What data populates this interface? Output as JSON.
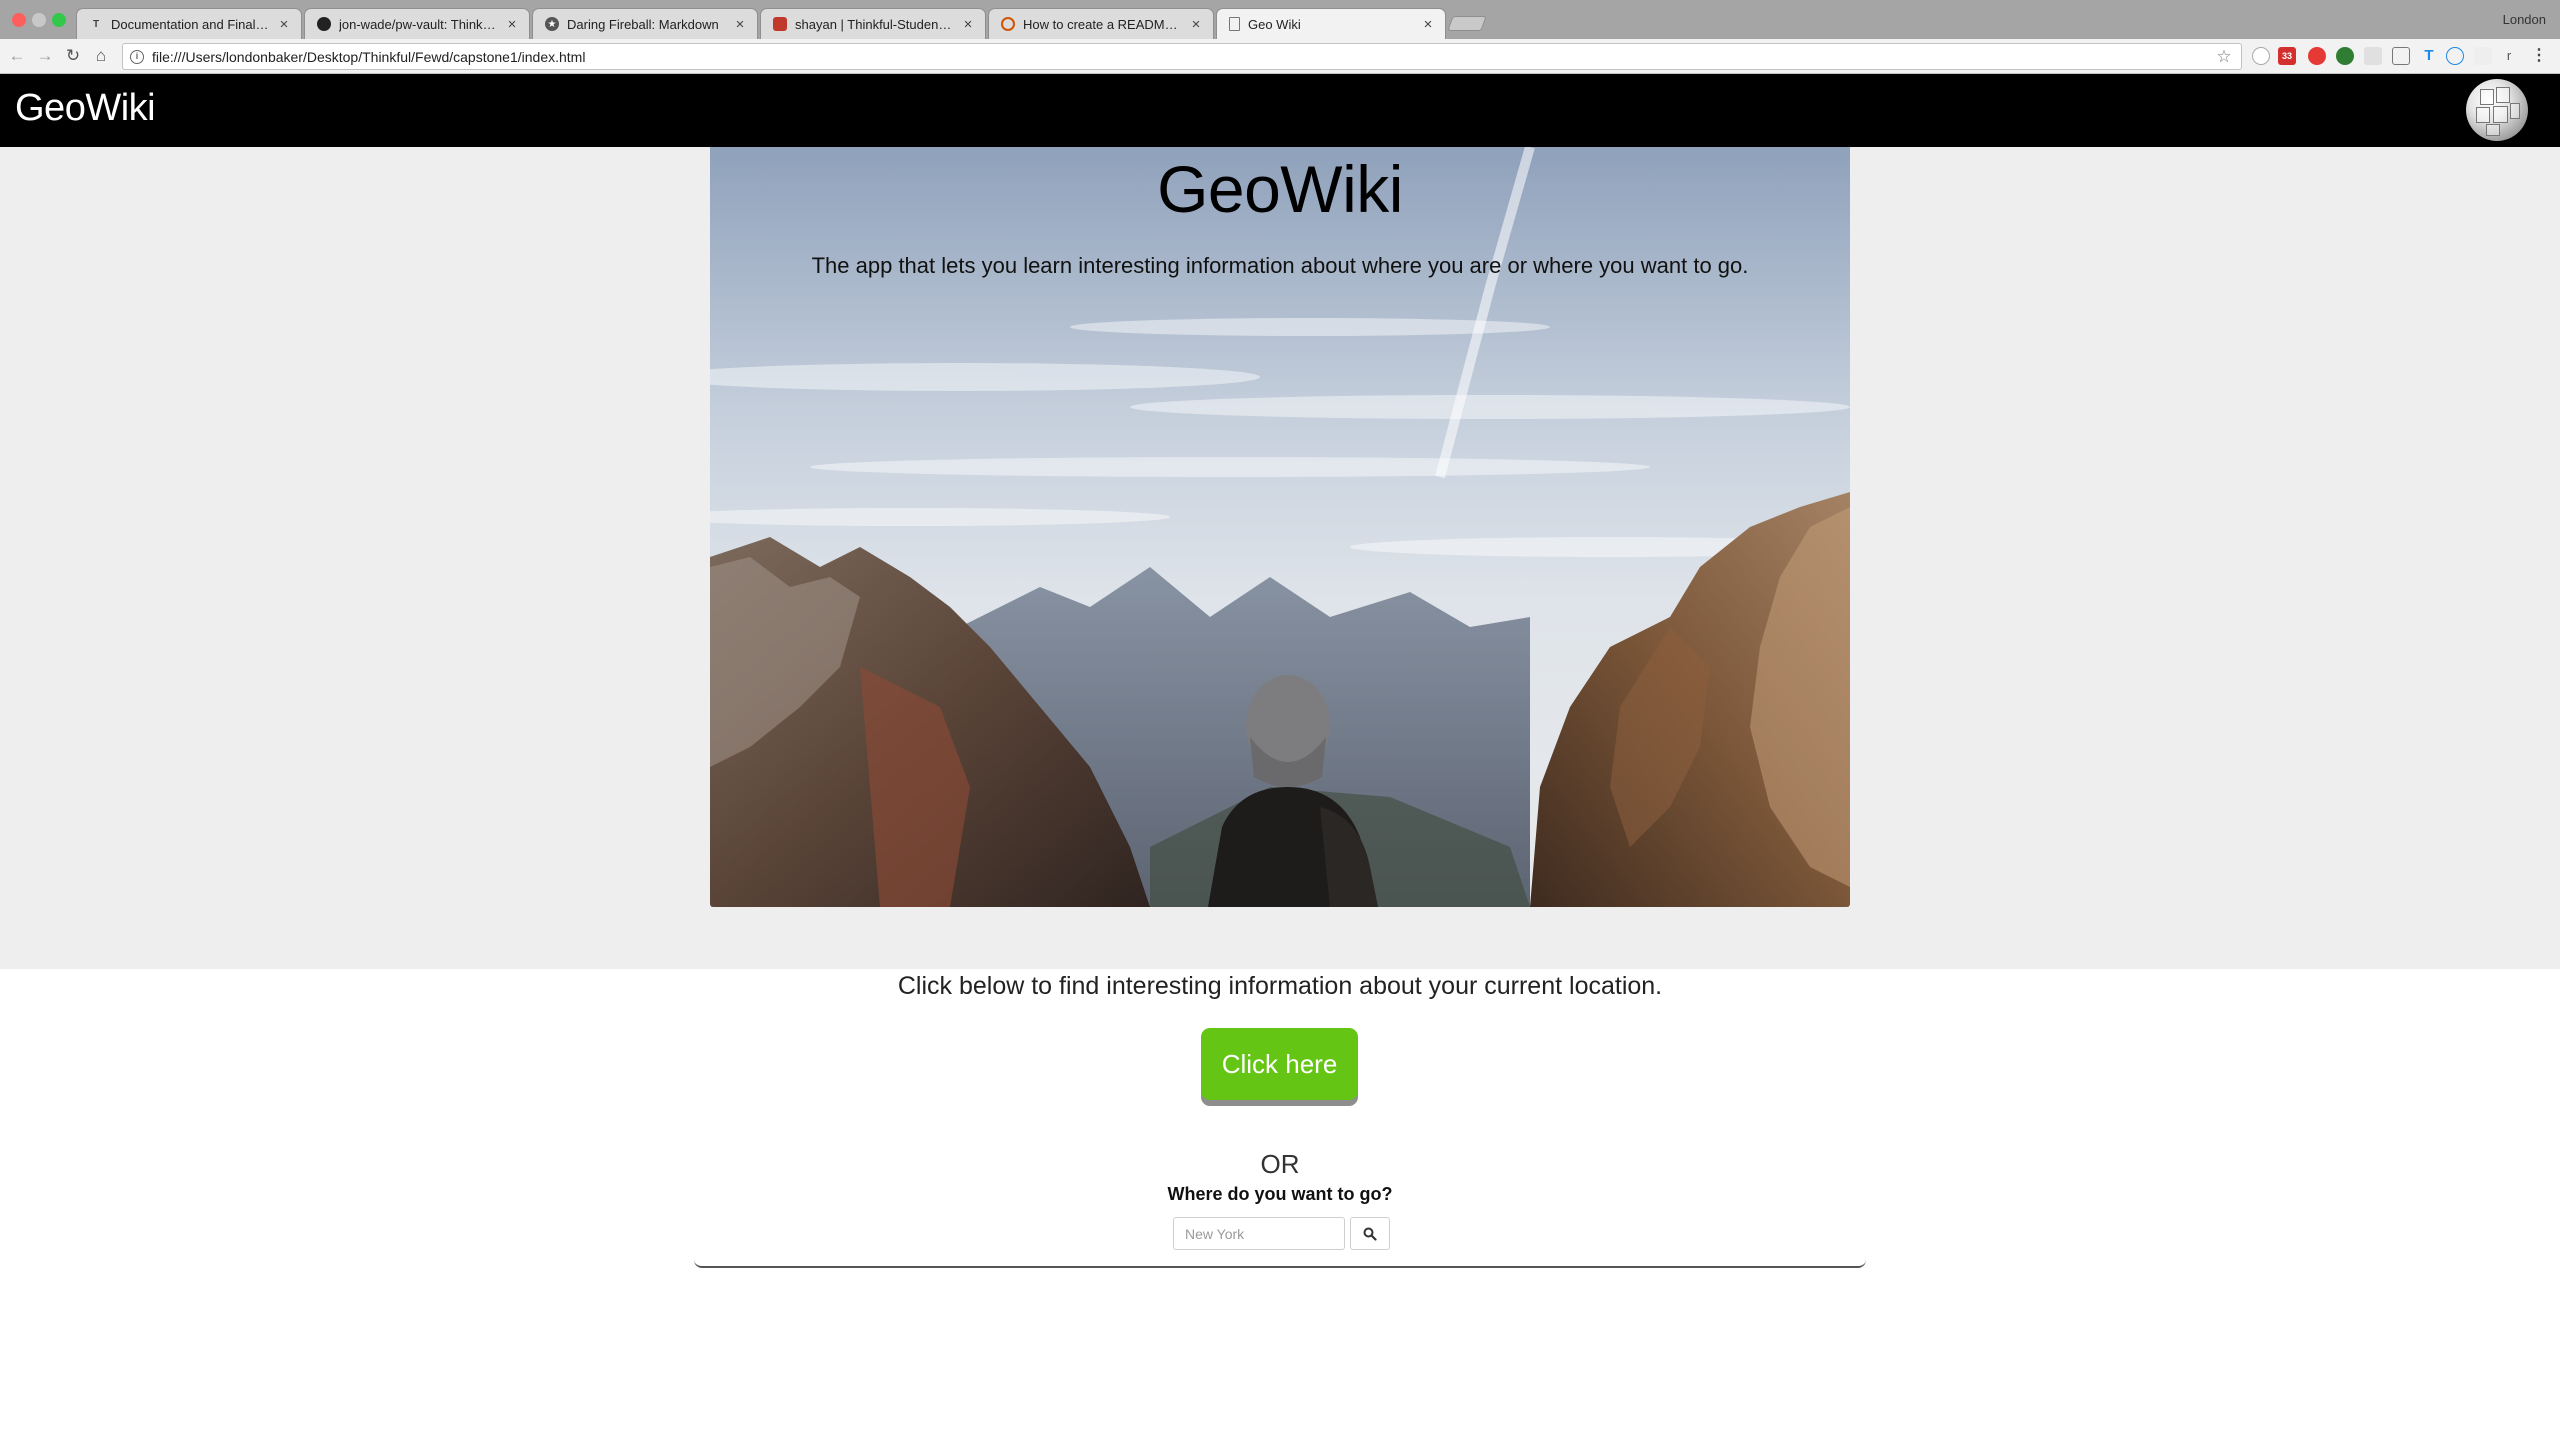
{
  "browser": {
    "tabs": [
      {
        "title": "Documentation and Final Clea",
        "icon": "t-icon"
      },
      {
        "title": "jon-wade/pw-vault: Thinkful e",
        "icon": "github-icon"
      },
      {
        "title": "Daring Fireball: Markdown",
        "icon": "star-icon"
      },
      {
        "title": "shayan | Thinkful-Students Sl",
        "icon": "slack-icon"
      },
      {
        "title": "How to create a README file i",
        "icon": "stackoverflow-icon"
      },
      {
        "title": "Geo Wiki",
        "icon": "page-icon"
      }
    ],
    "profile_name": "London",
    "url": "file:///Users/londonbaker/Desktop/Thinkful/Fewd/capstone1/index.html",
    "extension_badge": "33",
    "extension_letter": "r"
  },
  "navbar": {
    "brand": "GeoWiki",
    "logo_icon": "wikipedia-globe-icon"
  },
  "hero": {
    "title": "GeoWiki",
    "subtitle": "The app that lets you learn interesting information about where you are or where you want to go."
  },
  "location": {
    "prompt": "Click below to find interesting information about your current location.",
    "button_label": "Click here"
  },
  "search": {
    "or_label": "OR",
    "question": "Where do you want to go?",
    "placeholder": "New York",
    "button_icon": "search-icon"
  }
}
